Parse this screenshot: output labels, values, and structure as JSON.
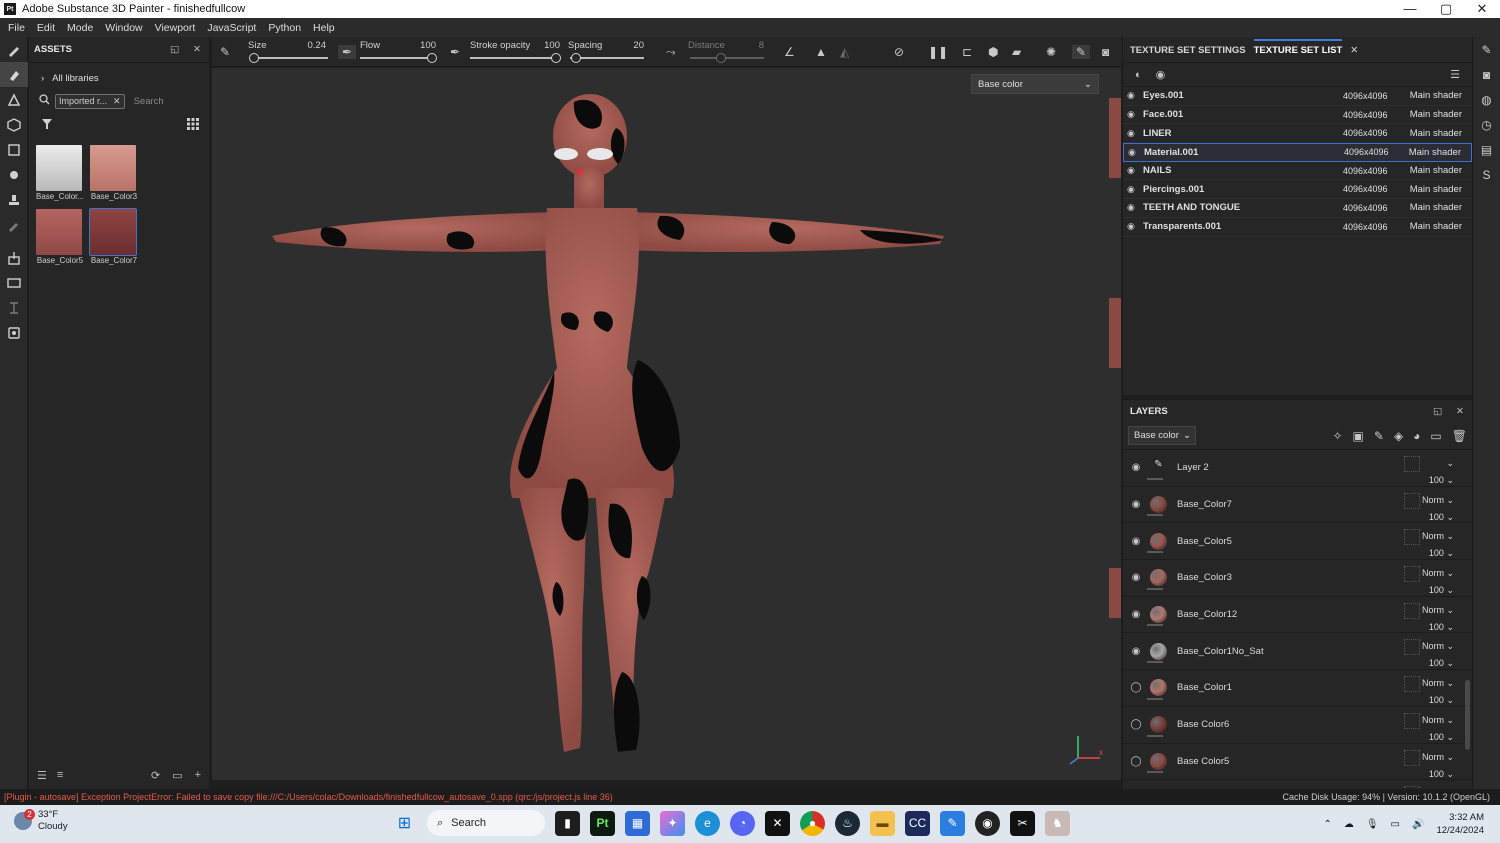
{
  "window": {
    "title": "Adobe Substance 3D Painter - finishedfullcow",
    "app_icon": "Pt",
    "minimize": "—",
    "maximize": "▢",
    "close": "✕"
  },
  "menu": [
    "File",
    "Edit",
    "Mode",
    "Window",
    "Viewport",
    "JavaScript",
    "Python",
    "Help"
  ],
  "assets": {
    "title": "ASSETS",
    "libraries": "All libraries",
    "filter_tag": "Imported r...",
    "search_placeholder": "Search",
    "thumbs": [
      {
        "label": "Base_Color...",
        "color": "#cfcfcf"
      },
      {
        "label": "Base_Color3",
        "color": "#cf8e83"
      },
      {
        "label": "Base_Color5",
        "color": "#a85a55"
      },
      {
        "label": "Base_Color7",
        "color": "#873c3c"
      }
    ]
  },
  "toolbar": {
    "size_label": "Size",
    "size_value": "0.24",
    "flow_label": "Flow",
    "flow_value": "100",
    "stroke_label": "Stroke opacity",
    "stroke_value": "100",
    "spacing_label": "Spacing",
    "spacing_value": "20",
    "distance_label": "Distance",
    "distance_value": "8"
  },
  "viewport": {
    "channel": "Base color",
    "axis_x": "x",
    "axis_u": "u"
  },
  "texture_sets": {
    "tab_settings": "TEXTURE SET SETTINGS",
    "tab_list": "TEXTURE SET LIST",
    "rows": [
      {
        "name": "Eyes.001",
        "res": "4096x4096",
        "shader": "Main shader"
      },
      {
        "name": "Face.001",
        "res": "4096x4096",
        "shader": "Main shader"
      },
      {
        "name": "LINER",
        "res": "4096x4096",
        "shader": "Main shader"
      },
      {
        "name": "Material.001",
        "res": "4096x4096",
        "shader": "Main shader"
      },
      {
        "name": "NAILS",
        "res": "4096x4096",
        "shader": "Main shader"
      },
      {
        "name": "Piercings.001",
        "res": "4096x4096",
        "shader": "Main shader"
      },
      {
        "name": "TEETH AND TONGUE",
        "res": "4096x4096",
        "shader": "Main shader"
      },
      {
        "name": "Transparents.001",
        "res": "4096x4096",
        "shader": "Main shader"
      }
    ]
  },
  "layers": {
    "title": "LAYERS",
    "channel": "Base color",
    "rows": [
      {
        "name": "Layer 2",
        "blend": "",
        "opacity": "100",
        "color": ""
      },
      {
        "name": "Base_Color7",
        "blend": "Norm",
        "opacity": "100",
        "color": "#8c4a44"
      },
      {
        "name": "Base_Color5",
        "blend": "Norm",
        "opacity": "100",
        "color": "#9b5650"
      },
      {
        "name": "Base_Color3",
        "blend": "Norm",
        "opacity": "100",
        "color": "#a8675e"
      },
      {
        "name": "Base_Color12",
        "blend": "Norm",
        "opacity": "100",
        "color": "#b07a70"
      },
      {
        "name": "Base_Color1No_Sat",
        "blend": "Norm",
        "opacity": "100",
        "color": "#a8a8a8"
      },
      {
        "name": "Base_Color1",
        "blend": "Norm",
        "opacity": "100",
        "color": "#b2746c"
      },
      {
        "name": "Base Color6",
        "blend": "Norm",
        "opacity": "100",
        "color": "#7a3e3a"
      },
      {
        "name": "Base Color5",
        "blend": "Norm",
        "opacity": "100",
        "color": "#8d4944"
      },
      {
        "name": "",
        "blend": "Norm",
        "opacity": "",
        "color": "#8a4a44"
      }
    ]
  },
  "status": {
    "error": "[Plugin - autosave] Exception ProjectError: Failed to save copy file:///C:/Users/colac/Downloads/finishedfullcow_autosave_0.spp (qrc:/js/project.js line 36)",
    "cache": "Cache Disk Usage:  94% | Version: 10.1.2 (OpenGL)"
  },
  "taskbar": {
    "weather_badge": "2",
    "temp": "33°F",
    "condition": "Cloudy",
    "search": "Search",
    "time": "3:32 AM",
    "date": "12/24/2024"
  }
}
